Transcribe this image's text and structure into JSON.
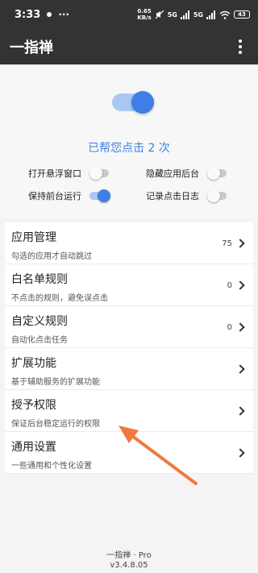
{
  "status_bar": {
    "time": "3:33",
    "net_speed_value": "0.65",
    "net_speed_unit": "KB/s",
    "signal_label_1": "5G",
    "signal_label_2": "5G",
    "battery": "43"
  },
  "app_bar": {
    "title": "一指禅"
  },
  "hero": {
    "click_count_text": "已帮您点击 2 次",
    "main_switch_on": true,
    "options": [
      {
        "label": "打开悬浮窗口",
        "on": false
      },
      {
        "label": "隐藏应用后台",
        "on": false
      },
      {
        "label": "保持前台运行",
        "on": true
      },
      {
        "label": "记录点击日志",
        "on": false
      }
    ]
  },
  "menu": {
    "items": [
      {
        "title": "应用管理",
        "subtitle": "勾选的应用才自动跳过",
        "count": "75"
      },
      {
        "title": "白名单规则",
        "subtitle": "不点击的规则，避免误点击",
        "count": "0"
      },
      {
        "title": "自定义规则",
        "subtitle": "自动化点击任务",
        "count": "0"
      },
      {
        "title": "扩展功能",
        "subtitle": "基于辅助服务的扩展功能",
        "count": ""
      },
      {
        "title": "授予权限",
        "subtitle": "保证后台稳定运行的权限",
        "count": ""
      },
      {
        "title": "通用设置",
        "subtitle": "一些通用和个性化设置",
        "count": ""
      }
    ]
  },
  "footer": {
    "line1": "一指禅 · Pro",
    "line2": "v3.4.8.05"
  },
  "colors": {
    "accent": "#3f7fe5",
    "annotation_arrow": "#f07a3e"
  }
}
